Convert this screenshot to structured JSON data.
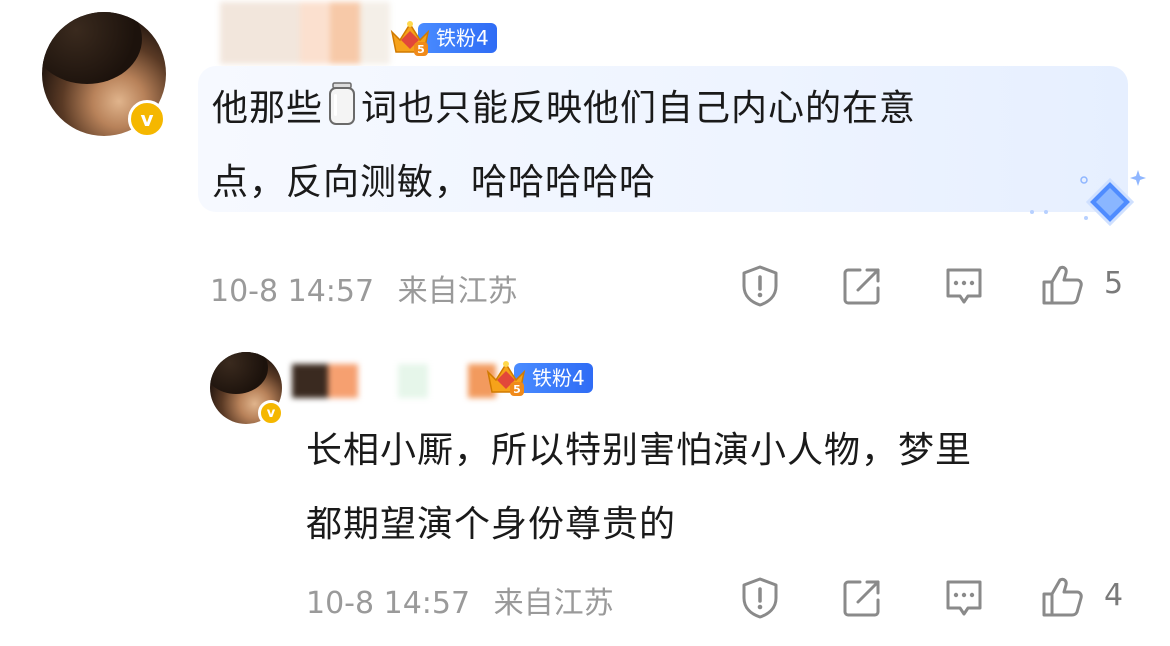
{
  "comment": {
    "badge_text": "铁粉4",
    "badge_level": "5",
    "verified_mark": "v",
    "text_line1_a": "他那些",
    "text_line1_b": "词也只能反映他们自己内心的在意",
    "text_line2": "点，反向测敏，哈哈哈哈哈",
    "time": "10-8 14:57",
    "location": "来自江苏",
    "like_count": "5"
  },
  "reply": {
    "badge_text": "铁粉4",
    "badge_level": "5",
    "verified_mark": "v",
    "text_line1": "长相小厮，所以特别害怕演小人物，梦里",
    "text_line2": "都期望演个身份尊贵的",
    "time": "10-8 14:57",
    "location": "来自江苏",
    "like_count": "4"
  },
  "icons": {
    "report": "report-icon",
    "repost": "repost-icon",
    "reply": "comment-icon",
    "like": "thumbs-up-icon",
    "jar": "jar-emoji-icon",
    "diamond": "diamond-sparkle-icon",
    "crown": "crown-badge-icon"
  },
  "colors": {
    "badge_blue": "#2f6cf5",
    "verified_gold": "#f5b700",
    "meta_gray": "#9a9a9a",
    "bubble_bg": "#eef4ff"
  }
}
